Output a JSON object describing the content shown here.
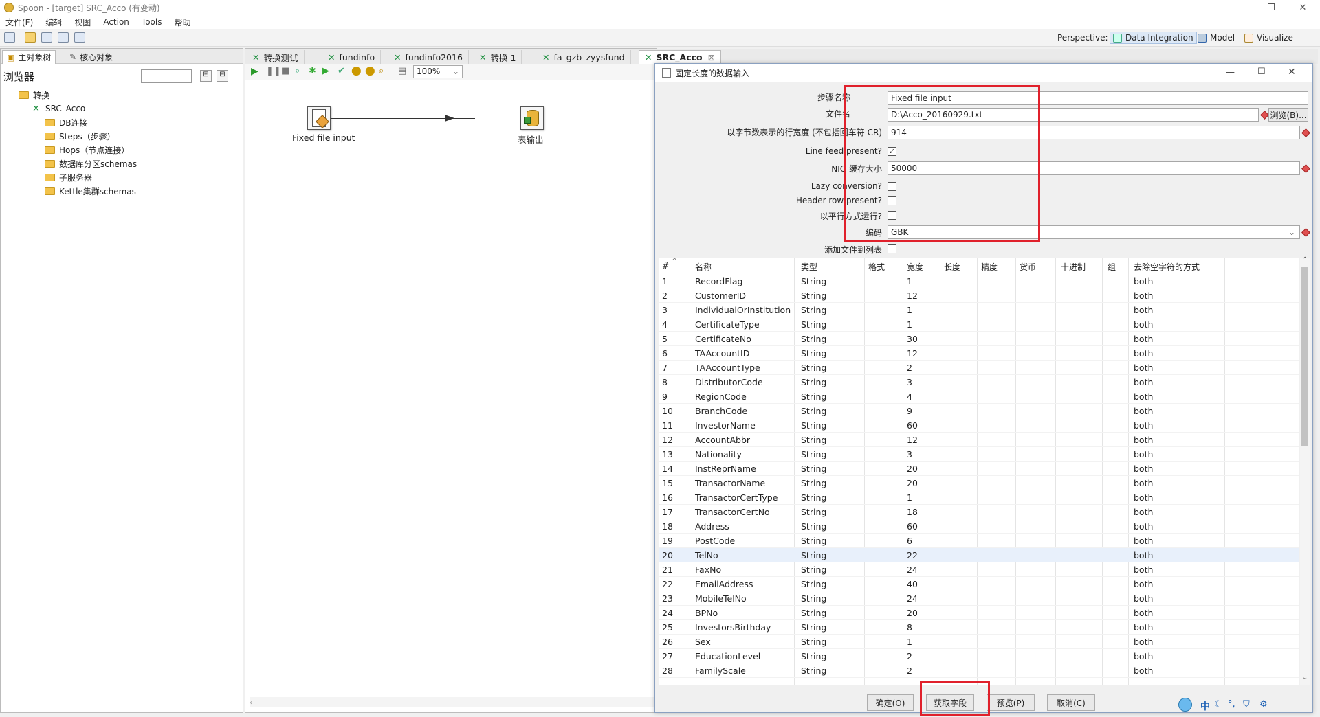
{
  "window": {
    "title": "Spoon - [target] SRC_Acco (有变动)"
  },
  "menu": [
    "文件(F)",
    "编辑",
    "视图",
    "Action",
    "Tools",
    "帮助"
  ],
  "perspective": {
    "label": "Perspective:",
    "items": [
      "Data Integration",
      "Model",
      "Visualize"
    ]
  },
  "left": {
    "tabs": [
      "主对象树",
      "核心对象"
    ],
    "browser_label": "浏览器",
    "tree": {
      "root": "转换",
      "trans": "SRC_Acco",
      "children": [
        "DB连接",
        "Steps（步骤）",
        "Hops（节点连接）",
        "数据库分区schemas",
        "子服务器",
        "Kettle集群schemas"
      ]
    }
  },
  "tabs": [
    "转换测试",
    "fundinfo",
    "fundinfo2016",
    "转换 1",
    "fa_gzb_zyysfund",
    "SRC_Acco"
  ],
  "canvas": {
    "zoom": "100%",
    "step1": "Fixed file input",
    "step2": "表输出"
  },
  "dialog": {
    "title": "固定长度的数据输入",
    "labels": {
      "step_name": "步骤名称",
      "filename": "文件名",
      "line_width": "以字节数表示的行宽度 (不包括回车符 CR)",
      "line_feed": "Line feed present?",
      "nio": "NIO 缓存大小",
      "lazy": "Lazy conversion?",
      "header": "Header row present?",
      "parallel": "以平行方式运行?",
      "encoding": "编码",
      "add_files": "添加文件到列表"
    },
    "values": {
      "step_name": "Fixed file input",
      "filename": "D:\\Acco_20160929.txt",
      "line_width": "914",
      "nio": "50000",
      "encoding": "GBK"
    },
    "browse": "浏览(B)...",
    "checkboxes": {
      "line_feed": true,
      "lazy": false,
      "header": false,
      "parallel": false,
      "add_files": false
    },
    "columns": [
      "#",
      "名称",
      "类型",
      "格式",
      "宽度",
      "长度",
      "精度",
      "货币",
      "十进制",
      "组",
      "去除空字符的方式"
    ],
    "rows": [
      [
        "1",
        "RecordFlag",
        "String",
        "1",
        "both"
      ],
      [
        "2",
        "CustomerID",
        "String",
        "12",
        "both"
      ],
      [
        "3",
        "IndividualOrInstitution",
        "String",
        "1",
        "both"
      ],
      [
        "4",
        "CertificateType",
        "String",
        "1",
        "both"
      ],
      [
        "5",
        "CertificateNo",
        "String",
        "30",
        "both"
      ],
      [
        "6",
        "TAAccountID",
        "String",
        "12",
        "both"
      ],
      [
        "7",
        "TAAccountType",
        "String",
        "2",
        "both"
      ],
      [
        "8",
        "DistributorCode",
        "String",
        "3",
        "both"
      ],
      [
        "9",
        "RegionCode",
        "String",
        "4",
        "both"
      ],
      [
        "10",
        "BranchCode",
        "String",
        "9",
        "both"
      ],
      [
        "11",
        "InvestorName",
        "String",
        "60",
        "both"
      ],
      [
        "12",
        "AccountAbbr",
        "String",
        "12",
        "both"
      ],
      [
        "13",
        "Nationality",
        "String",
        "3",
        "both"
      ],
      [
        "14",
        "InstReprName",
        "String",
        "20",
        "both"
      ],
      [
        "15",
        "TransactorName",
        "String",
        "20",
        "both"
      ],
      [
        "16",
        "TransactorCertType",
        "String",
        "1",
        "both"
      ],
      [
        "17",
        "TransactorCertNo",
        "String",
        "18",
        "both"
      ],
      [
        "18",
        "Address",
        "String",
        "60",
        "both"
      ],
      [
        "19",
        "PostCode",
        "String",
        "6",
        "both"
      ],
      [
        "20",
        "TelNo",
        "String",
        "22",
        "both"
      ],
      [
        "21",
        "FaxNo",
        "String",
        "24",
        "both"
      ],
      [
        "22",
        "EmailAddress",
        "String",
        "40",
        "both"
      ],
      [
        "23",
        "MobileTelNo",
        "String",
        "24",
        "both"
      ],
      [
        "24",
        "BPNo",
        "String",
        "20",
        "both"
      ],
      [
        "25",
        "InvestorsBirthday",
        "String",
        "8",
        "both"
      ],
      [
        "26",
        "Sex",
        "String",
        "1",
        "both"
      ],
      [
        "27",
        "EducationLevel",
        "String",
        "2",
        "both"
      ],
      [
        "28",
        "FamilyScale",
        "String",
        "2",
        "both"
      ]
    ],
    "buttons": {
      "ok": "确定(O)",
      "get_fields": "获取字段",
      "preview": "预览(P)",
      "cancel": "取消(C)"
    }
  },
  "tray": {
    "ime": "中"
  }
}
